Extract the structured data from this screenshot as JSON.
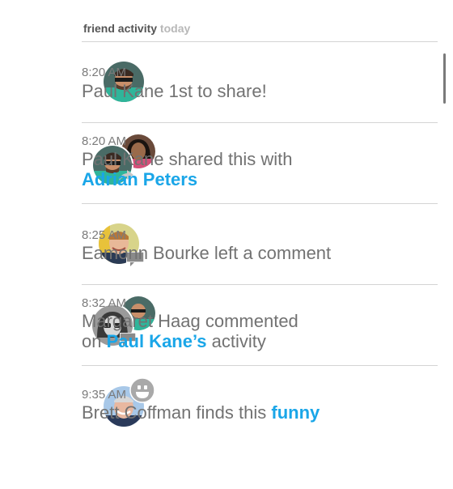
{
  "header": {
    "title": "friend activity",
    "subtitle": "today"
  },
  "items": [
    {
      "time": "8:20 AM",
      "text": "Paul Kane 1st to share!"
    },
    {
      "time": "8:20 AM",
      "text": "Paul Kane shared this with",
      "link": "Adrian Peters"
    },
    {
      "time": "8:25 AM",
      "text": "Eamonn Bourke left a comment"
    },
    {
      "time": "8:32 AM",
      "line1": "Margaret Haag commented",
      "line2_pre": "on",
      "link": "Paul Kane’s",
      "line2_post": "activity"
    },
    {
      "time": "9:35 AM",
      "text_pre": "Brett Coffman finds this",
      "link": "funny"
    }
  ],
  "colors": {
    "link": "#1aa6e8",
    "text": "#727272",
    "time": "#7b7b7b",
    "rule": "#d4d4d4"
  },
  "icons": [
    "share-arrow-icon",
    "comment-bubble-icon",
    "smiley-icon"
  ]
}
